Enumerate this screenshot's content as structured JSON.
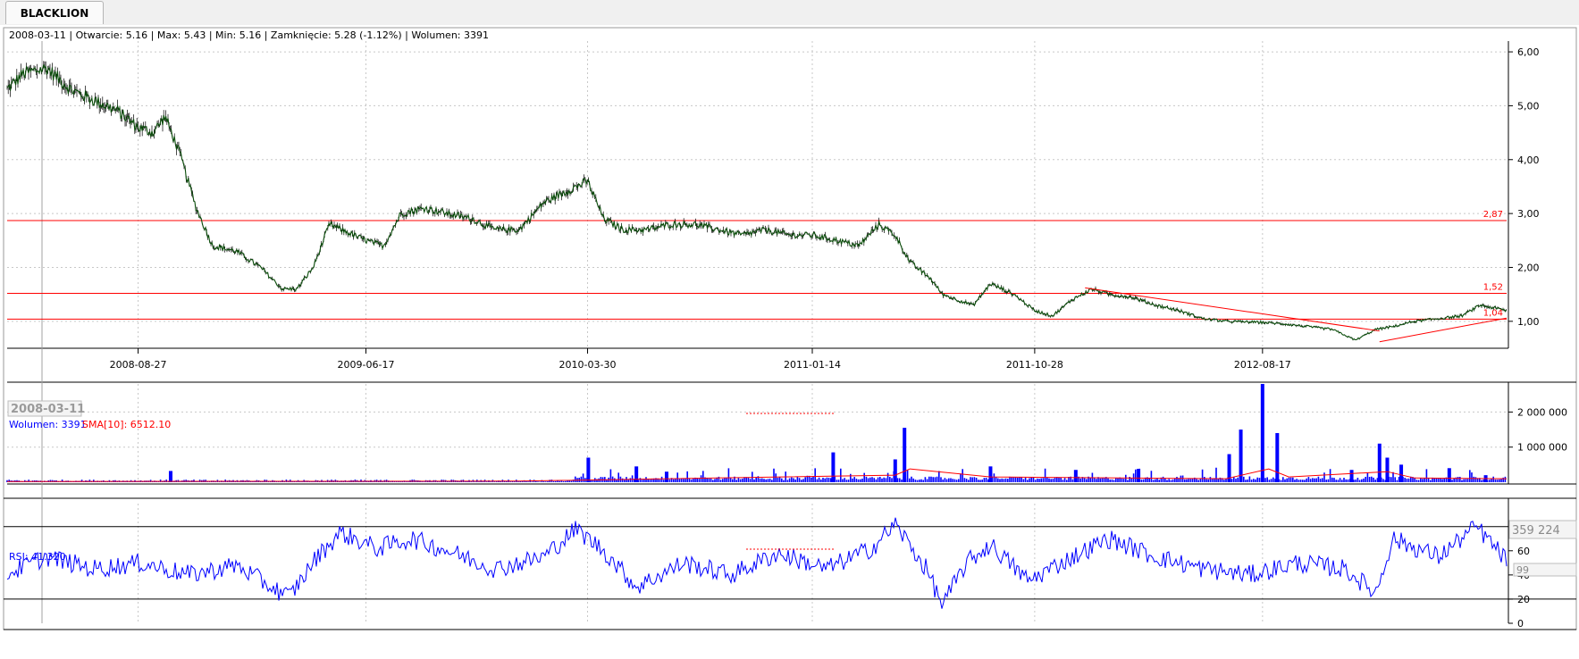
{
  "tab": {
    "label": "BLACKLION"
  },
  "info": {
    "price_line": "2008-03-11 | Otwarcie: 5.16 | Max: 5.43 | Min: 5.16 | Zamknięcie: 5.28 (-1.12%)  | Wolumen: 3391",
    "volume_label": "Wolumen: 3391",
    "sma_label": "SMA[10]: 6512.10",
    "rsi_label": "RSI: 41.320",
    "date_box": "2008-03-11",
    "vol_box": "359 224",
    "rsi_box": "99"
  },
  "colors": {
    "price_line": "#0a4d0a",
    "level_line": "#ff0000",
    "volume_bar": "#0000ff",
    "sma_line": "#ff0000",
    "rsi_line": "#0000ff",
    "grid": "#c8c8c8"
  },
  "chart_data": [
    {
      "type": "line",
      "panel": "price",
      "title": "",
      "ylim": [
        0.5,
        6.2
      ],
      "yticks": [
        "6,00",
        "5,00",
        "4,00",
        "3,00",
        "2,00",
        "1,00"
      ],
      "ytick_values": [
        6,
        5,
        4,
        3,
        2,
        1
      ],
      "x_ticks": [
        "2008-08-27",
        "2009-06-17",
        "2010-03-30",
        "2011-01-14",
        "2011-10-28",
        "2012-08-17"
      ],
      "x_range": [
        "2008-03-11",
        "2013-06-28"
      ],
      "grid": true,
      "series": [
        {
          "dates": [
            "2008-03-11",
            "2008-04-01",
            "2008-05-01",
            "2008-06-01",
            "2008-07-01",
            "2008-08-01",
            "2008-08-27",
            "2008-09-15",
            "2008-10-01",
            "2008-10-20",
            "2008-11-10",
            "2008-12-01",
            "2009-01-01",
            "2009-02-01",
            "2009-03-01",
            "2009-03-20",
            "2009-04-10",
            "2009-05-01",
            "2009-06-01",
            "2009-06-17",
            "2009-07-10",
            "2009-08-01",
            "2009-09-01",
            "2009-10-01",
            "2009-11-01",
            "2009-12-01",
            "2010-01-01",
            "2010-02-01",
            "2010-03-01",
            "2010-03-30",
            "2010-04-20",
            "2010-05-15",
            "2010-06-15",
            "2010-07-15",
            "2010-08-15",
            "2010-09-15",
            "2010-10-15",
            "2010-11-15",
            "2010-12-15",
            "2011-01-14",
            "2011-02-15",
            "2011-03-15",
            "2011-04-10",
            "2011-05-01",
            "2011-05-20",
            "2011-06-15",
            "2011-07-01",
            "2011-07-20",
            "2011-08-10",
            "2011-09-01",
            "2011-10-01",
            "2011-10-28",
            "2011-11-20",
            "2011-12-15",
            "2012-01-10",
            "2012-02-01",
            "2012-03-01",
            "2012-04-01",
            "2012-05-01",
            "2012-06-01",
            "2012-07-01",
            "2012-08-17",
            "2012-09-15",
            "2012-10-15",
            "2012-11-15",
            "2012-12-15",
            "2013-01-10",
            "2013-02-01",
            "2013-03-01",
            "2013-04-01",
            "2013-05-01",
            "2013-05-25",
            "2013-06-28"
          ],
          "values": [
            5.3,
            5.6,
            5.7,
            5.3,
            5.1,
            4.9,
            4.6,
            4.5,
            4.8,
            4.1,
            3.1,
            2.4,
            2.3,
            2.0,
            1.6,
            1.6,
            2.0,
            2.8,
            2.6,
            2.5,
            2.4,
            3.0,
            3.1,
            3.0,
            2.9,
            2.7,
            2.7,
            3.2,
            3.4,
            3.6,
            2.9,
            2.7,
            2.7,
            2.8,
            2.8,
            2.7,
            2.6,
            2.7,
            2.6,
            2.6,
            2.5,
            2.4,
            2.8,
            2.6,
            2.1,
            1.8,
            1.5,
            1.4,
            1.3,
            1.7,
            1.5,
            1.2,
            1.1,
            1.4,
            1.6,
            1.5,
            1.45,
            1.3,
            1.2,
            1.05,
            1.0,
            0.98,
            0.95,
            0.9,
            0.85,
            0.65,
            0.85,
            0.9,
            1.0,
            1.05,
            1.1,
            1.3,
            1.2
          ]
        }
      ],
      "levels": [
        {
          "value": 2.87,
          "label": "2,87"
        },
        {
          "value": 1.52,
          "label": "1,52"
        },
        {
          "value": 1.04,
          "label": "1,04"
        }
      ],
      "trend_lines": [
        {
          "from": [
            "2012-01-01",
            1.62
          ],
          "to": [
            "2013-01-15",
            0.82
          ]
        },
        {
          "from": [
            "2013-01-15",
            0.62
          ],
          "to": [
            "2013-06-28",
            1.06
          ]
        }
      ]
    },
    {
      "type": "bar",
      "panel": "volume",
      "title": "",
      "ylim": [
        0,
        2800000
      ],
      "yticks": [
        "2 000 000",
        "1 000 000"
      ],
      "ytick_values": [
        2000000,
        1000000
      ],
      "series": [
        {
          "name": "Wolumen",
          "dates": [
            "2008-10-08",
            "2010-03-31",
            "2010-06-01",
            "2010-07-10",
            "2011-02-10",
            "2011-05-01",
            "2011-05-13",
            "2011-09-01",
            "2011-12-20",
            "2012-03-10",
            "2012-07-05",
            "2012-07-20",
            "2012-08-17",
            "2012-09-05",
            "2012-12-10",
            "2013-01-15",
            "2013-01-25",
            "2013-02-12",
            "2013-04-15",
            "2013-06-01"
          ],
          "values": [
            320000,
            700000,
            450000,
            300000,
            850000,
            650000,
            1550000,
            450000,
            350000,
            380000,
            800000,
            1500000,
            2800000,
            1400000,
            350000,
            1100000,
            700000,
            500000,
            400000,
            200000
          ]
        },
        {
          "name": "SMA[10]",
          "dates": [
            "2008-03-11",
            "2010-01-01",
            "2011-05-01",
            "2011-05-20",
            "2011-09-01",
            "2012-07-01",
            "2012-08-25",
            "2012-09-20",
            "2013-01-25",
            "2013-03-01",
            "2013-06-28"
          ],
          "values": [
            20000,
            30000,
            200000,
            380000,
            150000,
            100000,
            380000,
            150000,
            300000,
            120000,
            100000
          ]
        }
      ]
    },
    {
      "type": "line",
      "panel": "rsi",
      "title": "",
      "ylim": [
        0,
        99
      ],
      "yticks": [
        "80",
        "60",
        "40",
        "20",
        "0"
      ],
      "ytick_values": [
        80,
        60,
        40,
        20,
        0
      ],
      "levels": [
        80,
        20
      ],
      "series": [
        {
          "name": "RSI",
          "dates": [
            "2008-03-11",
            "2008-05-01",
            "2008-07-01",
            "2008-09-01",
            "2008-11-01",
            "2009-01-01",
            "2009-02-15",
            "2009-03-10",
            "2009-04-15",
            "2009-05-15",
            "2009-07-01",
            "2009-08-15",
            "2009-10-01",
            "2009-12-01",
            "2010-02-01",
            "2010-03-15",
            "2010-04-20",
            "2010-06-01",
            "2010-08-01",
            "2010-10-01",
            "2010-12-01",
            "2011-02-01",
            "2011-04-01",
            "2011-05-01",
            "2011-06-10",
            "2011-07-01",
            "2011-08-01",
            "2011-09-01",
            "2011-10-20",
            "2011-12-01",
            "2012-02-01",
            "2012-04-01",
            "2012-06-01",
            "2012-08-01",
            "2012-10-01",
            "2012-12-01",
            "2013-01-10",
            "2013-02-01",
            "2013-04-01",
            "2013-05-20",
            "2013-06-28"
          ],
          "values": [
            41,
            55,
            45,
            50,
            40,
            48,
            30,
            22,
            55,
            75,
            62,
            70,
            60,
            45,
            55,
            78,
            60,
            30,
            50,
            40,
            58,
            45,
            62,
            82,
            45,
            15,
            50,
            65,
            35,
            50,
            70,
            55,
            45,
            40,
            50,
            45,
            25,
            70,
            55,
            80,
            52
          ]
        }
      ]
    }
  ]
}
